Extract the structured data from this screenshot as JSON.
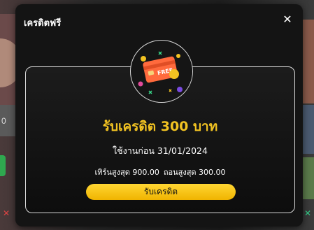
{
  "modal": {
    "title": "เครดิตฟรี",
    "close_icon": "close-icon",
    "badge": {
      "icon": "credit-card-icon",
      "card_label": "FREE",
      "colors": {
        "card": "#ff6a3d",
        "accent": "#f2c322"
      }
    },
    "heading": "รับเครดิต 300 บาท",
    "expiry_text": "ใช้งานก่อน 31/01/2024",
    "max_deposit_text": "เทิร์นสูงสุด 900.00",
    "max_withdraw_text": "ถอนสูงสุด 300.00",
    "claim_button_label": "รับเครดิต"
  },
  "colors": {
    "heading": "#f2c322",
    "button": "#ffcc00",
    "modal_bg": "#141414"
  },
  "background": {
    "left_digit": "0",
    "left_x": "✕",
    "right_x": "✕"
  }
}
